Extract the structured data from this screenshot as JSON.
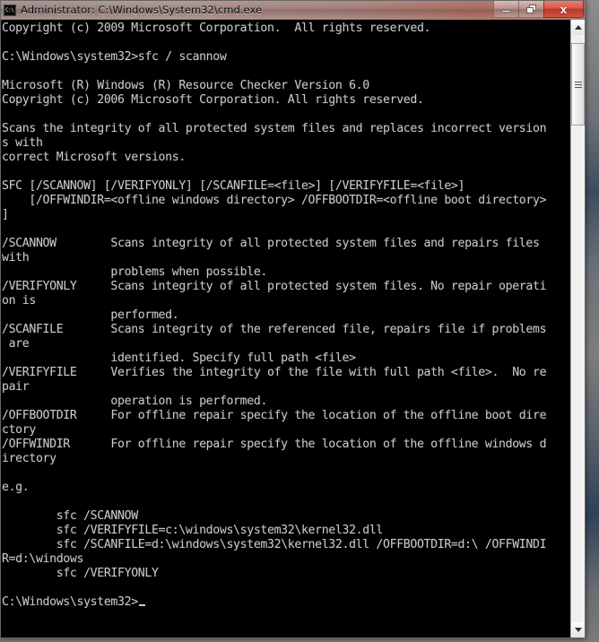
{
  "window": {
    "title": "Administrator: C:\\Windows\\System32\\cmd.exe",
    "icon_label": "C:\\",
    "controls": {
      "minimize": "—",
      "restore": "❐",
      "close": "x"
    }
  },
  "console": {
    "text": "Copyright (c) 2009 Microsoft Corporation.  All rights reserved.\n\nC:\\Windows\\system32>sfc / scannow\n\nMicrosoft (R) Windows (R) Resource Checker Version 6.0\nCopyright (c) 2006 Microsoft Corporation. All rights reserved.\n\nScans the integrity of all protected system files and replaces incorrect version\ns with\ncorrect Microsoft versions.\n\nSFC [/SCANNOW] [/VERIFYONLY] [/SCANFILE=<file>] [/VERIFYFILE=<file>]\n    [/OFFWINDIR=<offline windows directory> /OFFBOOTDIR=<offline boot directory>\n]\n\n/SCANNOW        Scans integrity of all protected system files and repairs files\nwith\n                problems when possible.\n/VERIFYONLY     Scans integrity of all protected system files. No repair operati\non is\n                performed.\n/SCANFILE       Scans integrity of the referenced file, repairs file if problems\n are\n                identified. Specify full path <file>\n/VERIFYFILE     Verifies the integrity of the file with full path <file>.  No re\npair\n                operation is performed.\n/OFFBOOTDIR     For offline repair specify the location of the offline boot dire\nctory\n/OFFWINDIR      For offline repair specify the location of the offline windows d\nirectory\n\ne.g.\n\n        sfc /SCANNOW\n        sfc /VERIFYFILE=c:\\windows\\system32\\kernel32.dll\n        sfc /SCANFILE=d:\\windows\\system32\\kernel32.dll /OFFBOOTDIR=d:\\ /OFFWINDI\nR=d:\\windows\n        sfc /VERIFYONLY\n\nC:\\Windows\\system32>",
    "prompt": "C:\\Windows\\system32>",
    "command_entered": "sfc / scannow",
    "foreground_color": "#c8c8c8",
    "background_color": "#000000"
  },
  "scrollbar": {
    "up_arrow": "▲",
    "down_arrow": "▼",
    "thumb_position_percent": 4
  }
}
